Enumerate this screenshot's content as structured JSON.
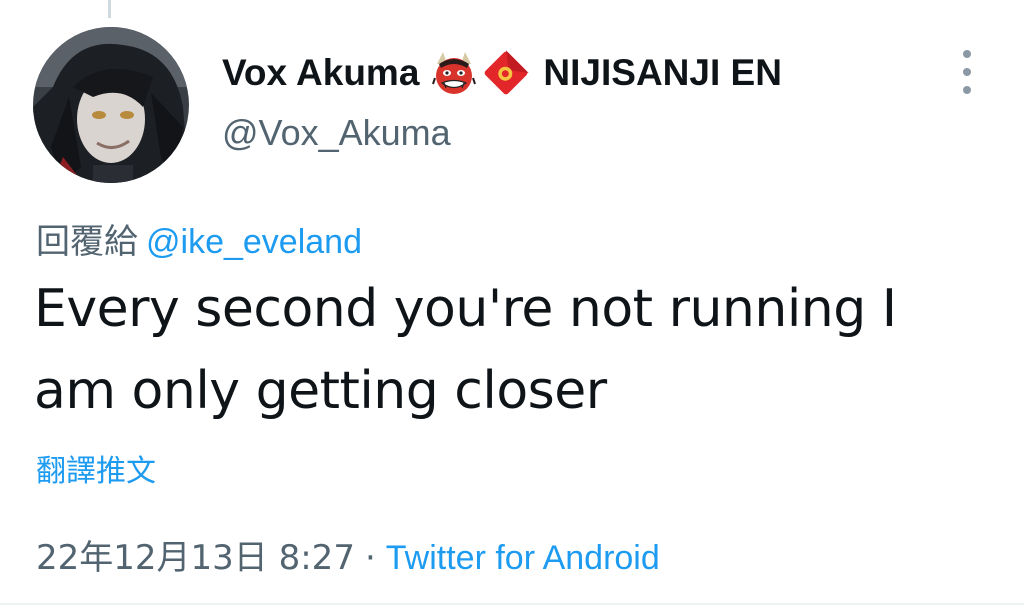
{
  "author": {
    "display_name": "Vox Akuma",
    "organization": "NIJISANJI EN",
    "handle": "@Vox_Akuma",
    "name_emojis": [
      "japanese-ogre-emoji",
      "red-envelope-emoji"
    ]
  },
  "reply": {
    "prefix": "回覆給",
    "mention": "@ike_eveland"
  },
  "tweet": {
    "text": "Every second you're not running I am only getting closer"
  },
  "translate_label": "翻譯推文",
  "meta": {
    "timestamp": "22年12月13日 8:27",
    "separator": "·",
    "source": "Twitter for Android"
  },
  "colors": {
    "text_primary": "#0f1419",
    "text_secondary": "#536471",
    "link": "#1d9bf0",
    "divider": "#eff3f4"
  }
}
